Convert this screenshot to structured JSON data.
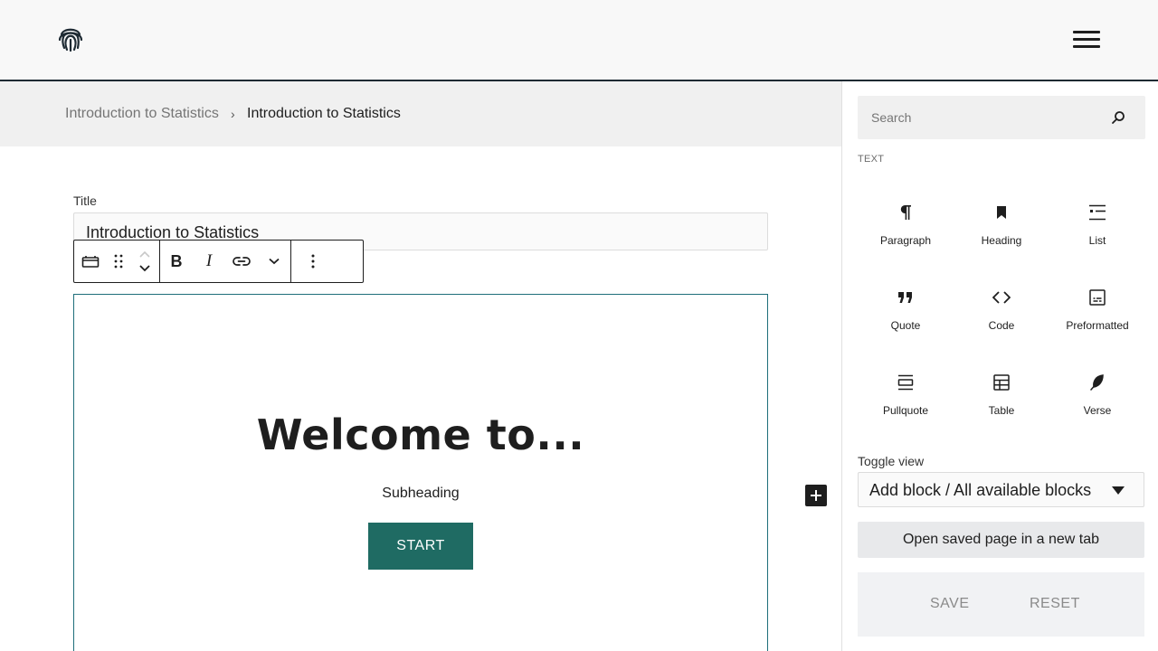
{
  "header": {
    "logo_icon": "fingerprint-icon",
    "menu_icon": "hamburger-menu-icon"
  },
  "breadcrumb": {
    "items": [
      "Introduction to Statistics",
      "Introduction to Statistics"
    ],
    "separator": "›"
  },
  "editor": {
    "title_label": "Title",
    "title_value": "Introduction to Statistics",
    "toolbar": {
      "buttons": [
        "block-type-icon",
        "drag-handle-icon",
        "move-up-icon",
        "move-down-icon",
        "bold-icon",
        "italic-icon",
        "link-icon",
        "more-formatting-chevron-icon",
        "options-kebab-icon"
      ],
      "bold_glyph": "B",
      "italic_glyph": "I"
    },
    "hero": {
      "heading": "Welcome to...",
      "subheading": "Subheading",
      "button_label": "START",
      "button_color": "#1f6b63"
    },
    "add_block_icon": "plus-icon",
    "selection_color": "#1e6e7a"
  },
  "sidebar": {
    "search": {
      "placeholder": "Search",
      "value": ""
    },
    "category_label": "TEXT",
    "blocks": [
      {
        "label": "Paragraph",
        "icon": "paragraph-icon"
      },
      {
        "label": "Heading",
        "icon": "heading-bookmark-icon"
      },
      {
        "label": "List",
        "icon": "list-icon"
      },
      {
        "label": "Quote",
        "icon": "quote-icon"
      },
      {
        "label": "Code",
        "icon": "code-icon"
      },
      {
        "label": "Preformatted",
        "icon": "preformatted-icon"
      },
      {
        "label": "Pullquote",
        "icon": "pullquote-icon"
      },
      {
        "label": "Table",
        "icon": "table-icon"
      },
      {
        "label": "Verse",
        "icon": "verse-feather-icon"
      }
    ],
    "toggle": {
      "label": "Toggle view",
      "selected": "Add block / All available blocks"
    },
    "open_saved_label": "Open saved page in a new tab",
    "save_label": "SAVE",
    "reset_label": "RESET"
  }
}
